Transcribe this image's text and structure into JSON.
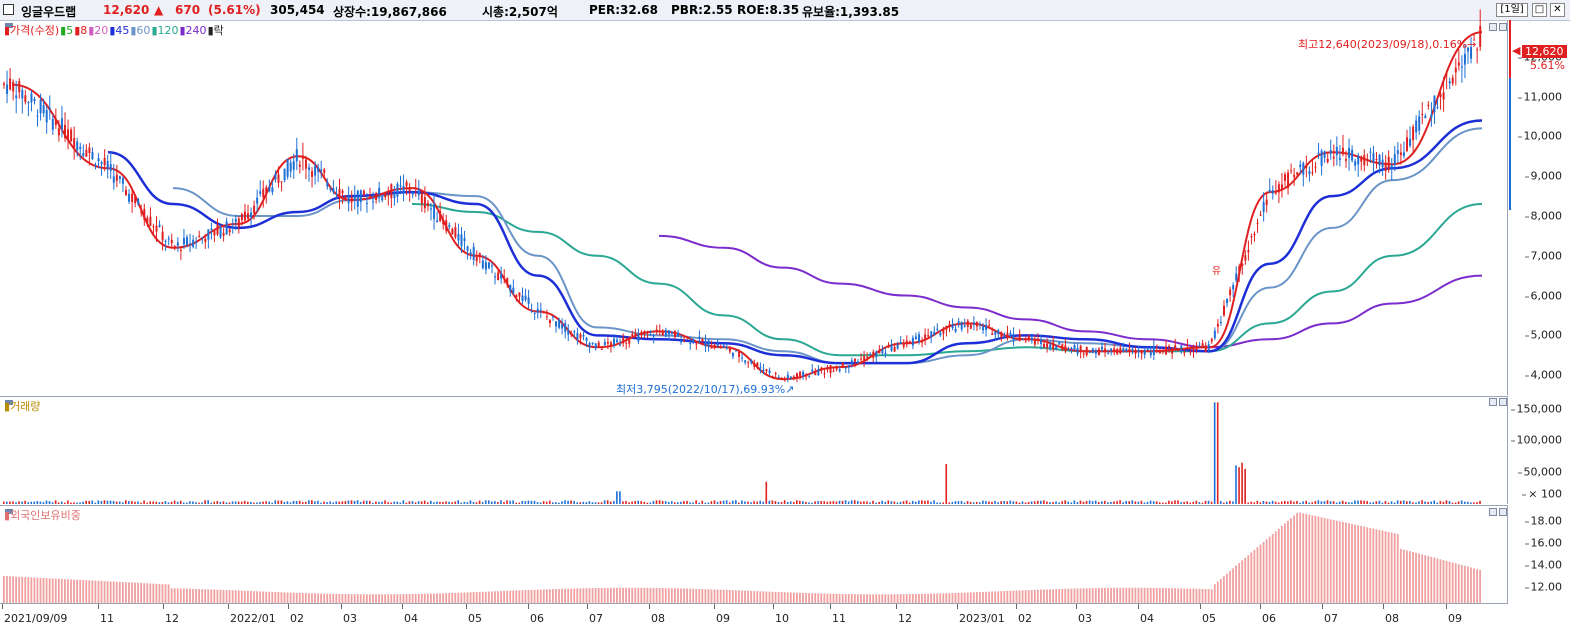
{
  "header": {
    "stock_name": "잉글우드랩",
    "price": "12,620",
    "change_arrow": "▲",
    "change": "670",
    "change_pct": "(5.61%)",
    "volume": "305,454",
    "listed_shares": "상장수:19,867,866",
    "market_cap": "시총:2,507억",
    "per": "PER:32.68",
    "pbr": "PBR:2.55",
    "roe": "ROE:8.35",
    "reserve": "유보율:1,393.85",
    "period_button": "[1일]",
    "maximize_icon": "□",
    "close_icon": "✕"
  },
  "price_panel": {
    "legend": [
      {
        "text": "가격(수정)",
        "color": "#e02020"
      },
      {
        "text": "5",
        "color": "#22aa22"
      },
      {
        "text": "8",
        "color": "#e02020"
      },
      {
        "text": "20",
        "color": "#d060c0"
      },
      {
        "text": "45",
        "color": "#1d2fd6"
      },
      {
        "text": "60",
        "color": "#6b94c8"
      },
      {
        "text": "120",
        "color": "#2aa893"
      },
      {
        "text": "240",
        "color": "#7a2ccc"
      },
      {
        "text": "락",
        "color": "#222222"
      }
    ],
    "current_price_label": "12,620",
    "current_pct_label": "5.61%",
    "high_annotation": "최고12,640(2023/09/18),0.16%",
    "low_annotation": "최저3,795(2022/10/17),69.93%",
    "event_marker": "유",
    "y_ticks": [
      "12,000",
      "11,000",
      "10,000",
      "9,000",
      "8,000",
      "7,000",
      "6,000",
      "5,000",
      "4,000"
    ]
  },
  "volume_panel": {
    "legend": "거래량",
    "y_ticks": [
      "150,000",
      "100,000",
      "50,000",
      "× 100"
    ]
  },
  "foreign_panel": {
    "legend": "외국인보유비중",
    "y_ticks": [
      "18.00",
      "16.00",
      "14.00",
      "12.00"
    ]
  },
  "x_axis_labels": [
    "2021/09/09",
    "11",
    "12",
    "2022/01",
    "02",
    "03",
    "04",
    "05",
    "06",
    "07",
    "08",
    "09",
    "10",
    "11",
    "12",
    "2023/01",
    "02",
    "03",
    "04",
    "05",
    "06",
    "07",
    "08",
    "09"
  ],
  "colors": {
    "up": "#e02020",
    "down": "#1d6fd6",
    "ma5": "#22aa22",
    "ma8": "#e02020",
    "ma20": "#d060c0",
    "ma45": "#1d2fd6",
    "ma60": "#6b94c8",
    "ma120": "#2aa893",
    "ma240": "#7a2ccc",
    "foreign_bar": "#f0a0a0"
  },
  "chart_data": {
    "type": "line",
    "title": "",
    "price_range": [
      3500,
      12900
    ],
    "series": [
      {
        "name": "가격(수정)",
        "x": [
          "2021/09",
          "2021/11",
          "2021/12",
          "2022/01",
          "2022/02",
          "2022/03",
          "2022/04",
          "2022/05",
          "2022/06",
          "2022/07",
          "2022/08",
          "2022/09",
          "2022/10",
          "2022/11",
          "2022/12",
          "2023/01",
          "2023/02",
          "2023/03",
          "2023/04",
          "2023/05",
          "2023/06",
          "2023/07",
          "2023/08",
          "2023/09"
        ],
        "values": [
          11300,
          9200,
          7200,
          7800,
          9500,
          8400,
          8700,
          7000,
          5600,
          4700,
          5100,
          4700,
          3900,
          4200,
          4800,
          5300,
          4900,
          4600,
          4600,
          4700,
          8600,
          9600,
          9300,
          12620
        ]
      },
      {
        "name": "45",
        "values": [
          null,
          9600,
          8300,
          7700,
          8100,
          8500,
          8600,
          8300,
          6500,
          5000,
          4900,
          4800,
          4500,
          4300,
          4300,
          4800,
          5000,
          4900,
          4700,
          4600,
          6800,
          8500,
          9200,
          10400
        ]
      },
      {
        "name": "60",
        "values": [
          null,
          null,
          8700,
          8000,
          8000,
          8400,
          8600,
          8500,
          7000,
          5200,
          5000,
          4900,
          4600,
          4300,
          4300,
          4500,
          4900,
          4800,
          4700,
          4600,
          6200,
          7700,
          8900,
          10200
        ]
      },
      {
        "name": "120",
        "values": [
          null,
          null,
          null,
          null,
          null,
          null,
          8300,
          8100,
          7600,
          7000,
          6300,
          5500,
          4900,
          4500,
          4500,
          4600,
          4700,
          4600,
          4600,
          4600,
          5300,
          6100,
          7000,
          8300
        ]
      },
      {
        "name": "240",
        "values": [
          null,
          null,
          null,
          null,
          null,
          null,
          null,
          null,
          null,
          null,
          7500,
          7200,
          6700,
          6300,
          6000,
          5700,
          5400,
          5100,
          4900,
          4700,
          4900,
          5300,
          5800,
          6500
        ]
      }
    ],
    "volume_ticks": [
      150000,
      100000,
      50000
    ],
    "foreign_ratio_range": [
      10.5,
      19.5
    ]
  }
}
